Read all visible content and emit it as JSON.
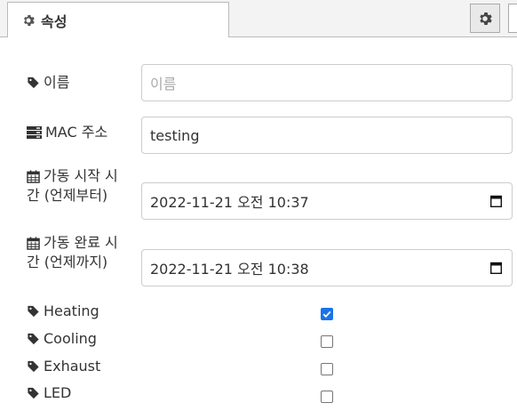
{
  "tab": {
    "label": "속성"
  },
  "icons": {
    "tab": "gear-icon",
    "settings_button": "gear-icon",
    "tag": "tag-icon",
    "mac": "server-icon",
    "date": "calendar-icon"
  },
  "fields": {
    "name": {
      "label": "이름",
      "placeholder": "이름",
      "value": ""
    },
    "mac": {
      "label": "MAC 주소",
      "value": "testing"
    },
    "start": {
      "label_line1": "가동 시작 시",
      "label_line2": "간 (언제부터)",
      "value": "2022-11-21 오전 10:37"
    },
    "end": {
      "label_line1": "가동 완료 시",
      "label_line2": "간 (언제까지)",
      "value": "2022-11-21 오전 10:38"
    }
  },
  "checkboxes": [
    {
      "label": "Heating",
      "checked": true
    },
    {
      "label": "Cooling",
      "checked": false
    },
    {
      "label": "Exhaust",
      "checked": false
    },
    {
      "label": "LED",
      "checked": false
    }
  ],
  "colors": {
    "accent": "#1a73e8",
    "border": "#cccccc",
    "tabbar": "#f3f3f3"
  }
}
